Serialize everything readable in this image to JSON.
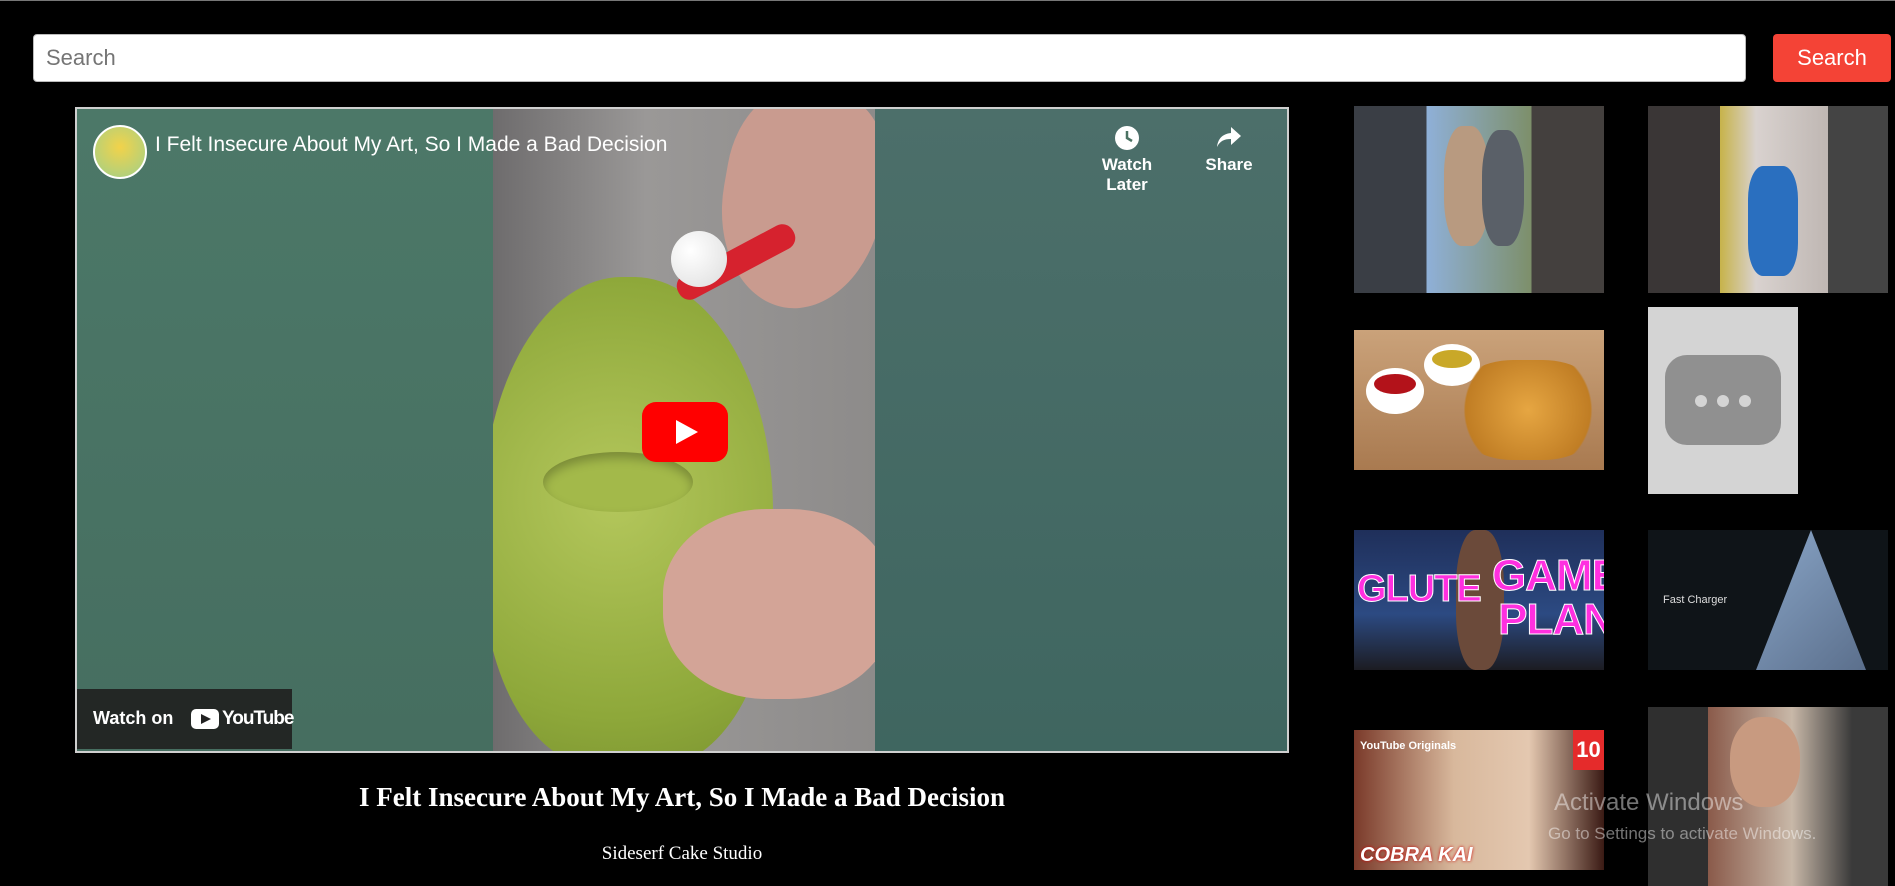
{
  "search": {
    "placeholder": "Search",
    "button_label": "Search"
  },
  "player": {
    "title": "I Felt Insecure About My Art, So I Made a Bad Decision",
    "watch_later_label": "Watch Later",
    "share_label": "Share",
    "watch_on_label": "Watch on",
    "youtube_label": "YouTube",
    "play_button_color": "#ff0000"
  },
  "video": {
    "title": "I Felt Insecure About My Art, So I Made a Bad Decision",
    "channel": "Sideserf Cake Studio"
  },
  "thumbnails": {
    "t5_text_left": "GLUTE",
    "t5_text_right_1": "GAME",
    "t5_text_right_2": "PLAN",
    "t6_text": "Fast Charger",
    "t7_originals": "YouTube Originals",
    "t7_number": "10",
    "t7_logo": "COBRA KAI"
  },
  "os_watermark": {
    "line1": "Activate Windows",
    "line2": "Go to Settings to activate Windows."
  },
  "colors": {
    "search_button": "#f44336",
    "background": "#000000"
  }
}
